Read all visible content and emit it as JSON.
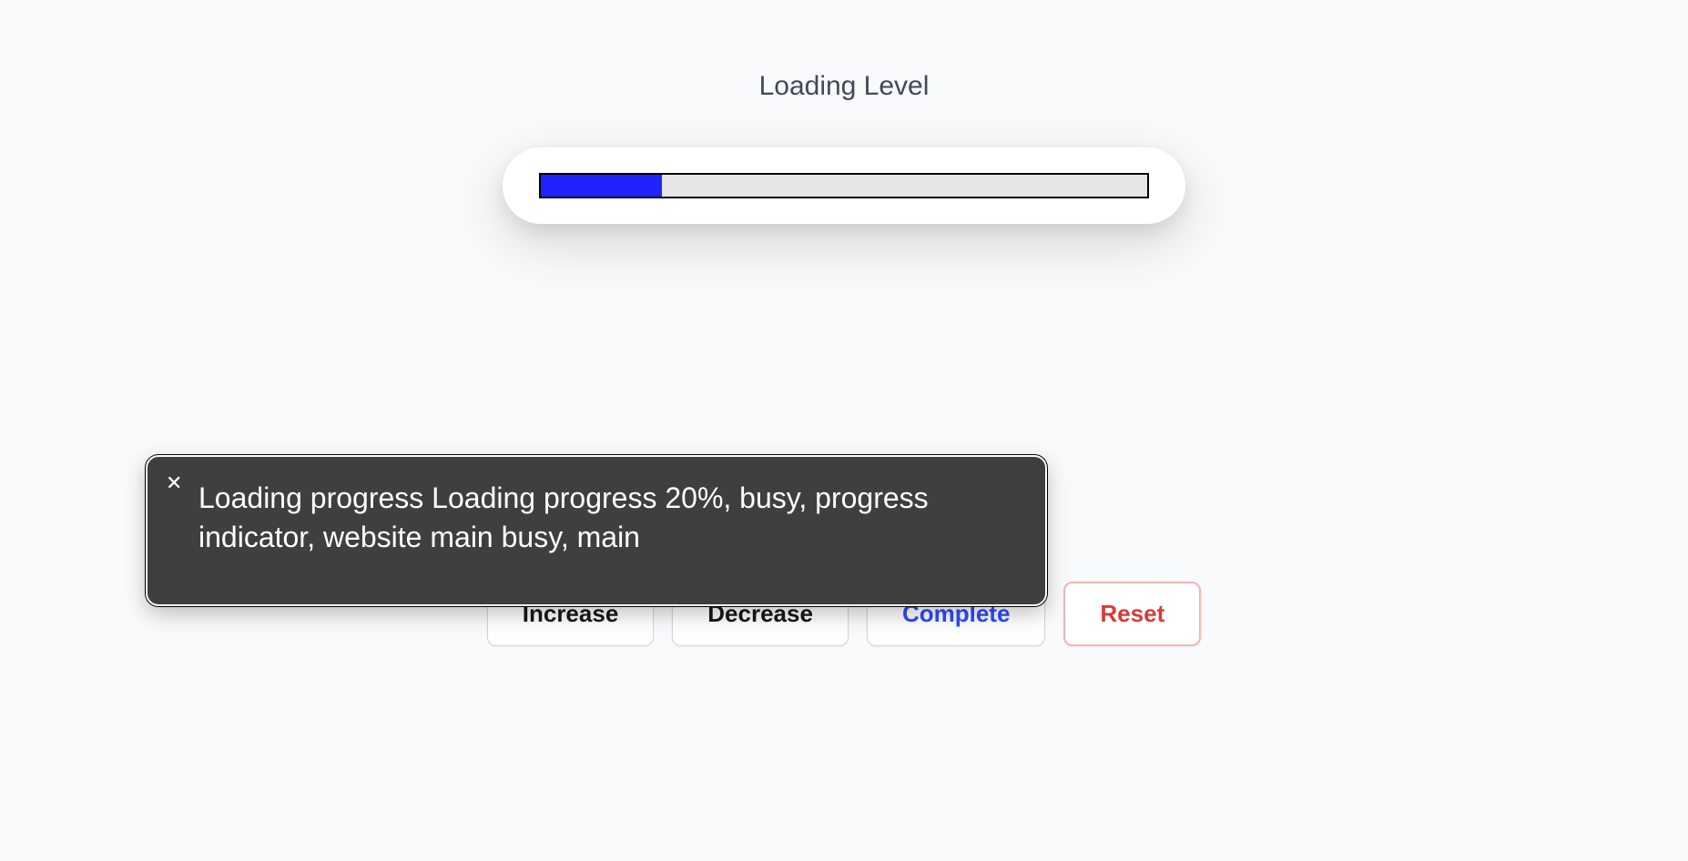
{
  "title": "Loading Level",
  "progress": {
    "percent": 20
  },
  "buttons": {
    "increase": "Increase",
    "decrease": "Decrease",
    "complete": "Complete",
    "reset": "Reset"
  },
  "tooltip": {
    "text": "Loading progress Loading progress 20%, busy, progress indicator, website main busy, main"
  }
}
